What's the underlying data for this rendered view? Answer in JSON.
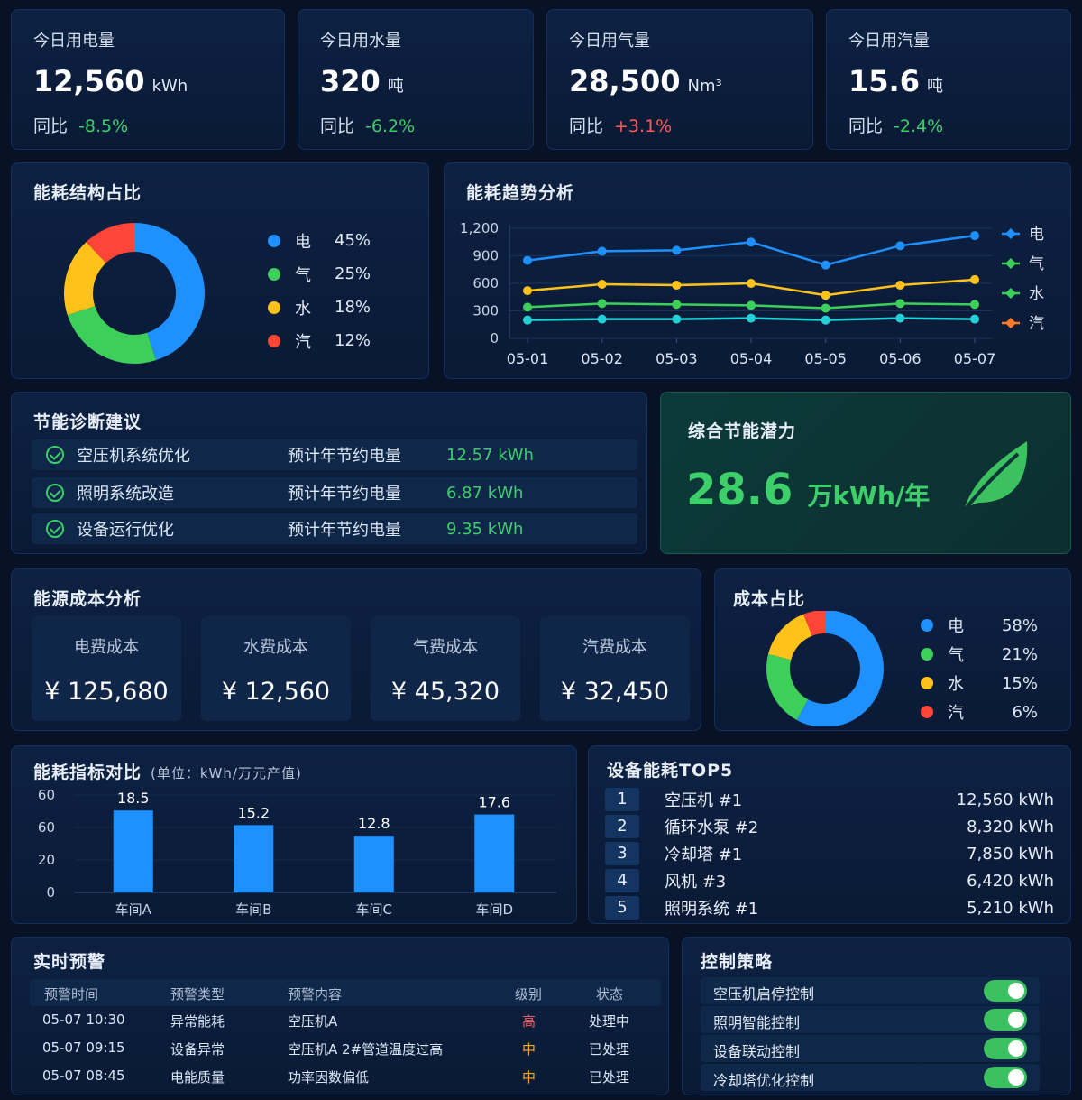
{
  "kpis": [
    {
      "label": "今日用电量",
      "value": "12,560",
      "unit": "kWh",
      "yoy_label": "同比",
      "yoy": "-8.5%",
      "trend": "down"
    },
    {
      "label": "今日用水量",
      "value": "320",
      "unit": "吨",
      "yoy_label": "同比",
      "yoy": "-6.2%",
      "trend": "down"
    },
    {
      "label": "今日用气量",
      "value": "28,500",
      "unit": "Nm³",
      "yoy_label": "同比",
      "yoy": "+3.1%",
      "trend": "up"
    },
    {
      "label": "今日用汽量",
      "value": "15.6",
      "unit": "吨",
      "yoy_label": "同比",
      "yoy": "-2.4%",
      "trend": "down"
    }
  ],
  "structure": {
    "title": "能耗结构占比",
    "items": [
      {
        "name": "电",
        "pct": "45%",
        "value": 45,
        "color": "#1e90ff"
      },
      {
        "name": "气",
        "pct": "25%",
        "value": 25,
        "color": "#3ccf5a"
      },
      {
        "name": "水",
        "pct": "18%",
        "value": 18,
        "color": "#ffc21a"
      },
      {
        "name": "汽",
        "pct": "12%",
        "value": 12,
        "color": "#ff4438"
      }
    ]
  },
  "trend": {
    "title": "能耗趋势分析"
  },
  "chart_data": [
    {
      "type": "line",
      "x": [
        "05-01",
        "05-02",
        "05-03",
        "05-04",
        "05-05",
        "05-06",
        "05-07"
      ],
      "yticks": [
        "0",
        "300",
        "600",
        "900",
        "1,200"
      ],
      "ylim": [
        0,
        1200
      ],
      "series": [
        {
          "name": "电",
          "color": "#1e90ff",
          "values": [
            850,
            950,
            960,
            1050,
            800,
            1010,
            1120
          ]
        },
        {
          "name": "气",
          "color": "#3ccf5a",
          "values": [
            340,
            380,
            370,
            360,
            330,
            380,
            370
          ]
        },
        {
          "name": "水",
          "color": "#ffc21a",
          "values": [
            520,
            590,
            580,
            600,
            470,
            580,
            640
          ]
        },
        {
          "name": "汽",
          "color": "#22d0d8",
          "values": [
            200,
            210,
            210,
            220,
            200,
            220,
            210
          ]
        }
      ],
      "legend": [
        {
          "name": "电",
          "color": "#1e90ff"
        },
        {
          "name": "气",
          "color": "#3ccf5a"
        },
        {
          "name": "水",
          "color": "#3ccf5a"
        },
        {
          "name": "汽",
          "color": "#ff7a2a"
        }
      ],
      "legend_position": "right"
    },
    {
      "type": "bar",
      "categories": [
        "车间A",
        "车间B",
        "车间C",
        "车间D"
      ],
      "values": [
        18.5,
        15.2,
        12.8,
        17.6
      ],
      "value_labels": [
        "18.5",
        "15.2",
        "12.8",
        "17.6"
      ],
      "yticks": [
        "0",
        "20",
        "60",
        "60"
      ],
      "ylim": [
        0,
        22
      ]
    }
  ],
  "diagnosis": {
    "title": "节能诊断建议",
    "rows": [
      {
        "name": "空压机系统优化",
        "label": "预计年节约电量",
        "value": "12.57 kWh"
      },
      {
        "name": "照明系统改造",
        "label": "预计年节约电量",
        "value": "6.87 kWh"
      },
      {
        "name": "设备运行优化",
        "label": "预计年节约电量",
        "value": "9.35 kWh"
      }
    ]
  },
  "potential": {
    "title": "综合节能潜力",
    "value": "28.6",
    "unit": "万kWh/年",
    "icon": "leaf-icon"
  },
  "cost": {
    "title": "能源成本分析",
    "items": [
      {
        "label": "电费成本",
        "value": "¥ 125,680"
      },
      {
        "label": "水费成本",
        "value": "¥ 12,560"
      },
      {
        "label": "气费成本",
        "value": "¥ 45,320"
      },
      {
        "label": "汽费成本",
        "value": "¥ 32,450"
      }
    ]
  },
  "cost_share": {
    "title": "成本占比",
    "items": [
      {
        "name": "电",
        "pct": "58%",
        "value": 58,
        "color": "#1e90ff"
      },
      {
        "name": "气",
        "pct": "21%",
        "value": 21,
        "color": "#3ccf5a"
      },
      {
        "name": "水",
        "pct": "15%",
        "value": 15,
        "color": "#ffc21a"
      },
      {
        "name": "汽",
        "pct": "6%",
        "value": 6,
        "color": "#ff4438"
      }
    ]
  },
  "indicator": {
    "title": "能耗指标对比",
    "unit": "(单位：kWh/万元产值)"
  },
  "top5": {
    "title": "设备能耗TOP5",
    "rows": [
      {
        "rank": "1",
        "name": "空压机 #1",
        "value": "12,560",
        "unit": "kWh"
      },
      {
        "rank": "2",
        "name": "循环水泵 #2",
        "value": "8,320",
        "unit": "kWh"
      },
      {
        "rank": "3",
        "name": "冷却塔 #1",
        "value": "7,850",
        "unit": "kWh"
      },
      {
        "rank": "4",
        "name": "风机 #3",
        "value": "6,420",
        "unit": "kWh"
      },
      {
        "rank": "5",
        "name": "照明系统 #1",
        "value": "5,210",
        "unit": "kWh"
      }
    ]
  },
  "alerts": {
    "title": "实时预警",
    "headers": [
      "预警时间",
      "预警类型",
      "预警内容",
      "级别",
      "状态"
    ],
    "rows": [
      {
        "time": "05-07 10:30",
        "type": "异常能耗",
        "content": "空压机A",
        "level": "高",
        "level_color": "#ff4438",
        "status": "处理中"
      },
      {
        "time": "05-07 09:15",
        "type": "设备异常",
        "content": "空压机A 2#管道温度过高",
        "level": "中",
        "level_color": "#ffa528",
        "status": "已处理"
      },
      {
        "time": "05-07 08:45",
        "type": "电能质量",
        "content": "功率因数偏低",
        "level": "中",
        "level_color": "#ffa528",
        "status": "已处理"
      }
    ]
  },
  "control": {
    "title": "控制策略",
    "items": [
      {
        "label": "空压机启停控制",
        "on": true
      },
      {
        "label": "照明智能控制",
        "on": true
      },
      {
        "label": "设备联动控制",
        "on": true
      },
      {
        "label": "冷却塔优化控制",
        "on": true
      }
    ]
  }
}
